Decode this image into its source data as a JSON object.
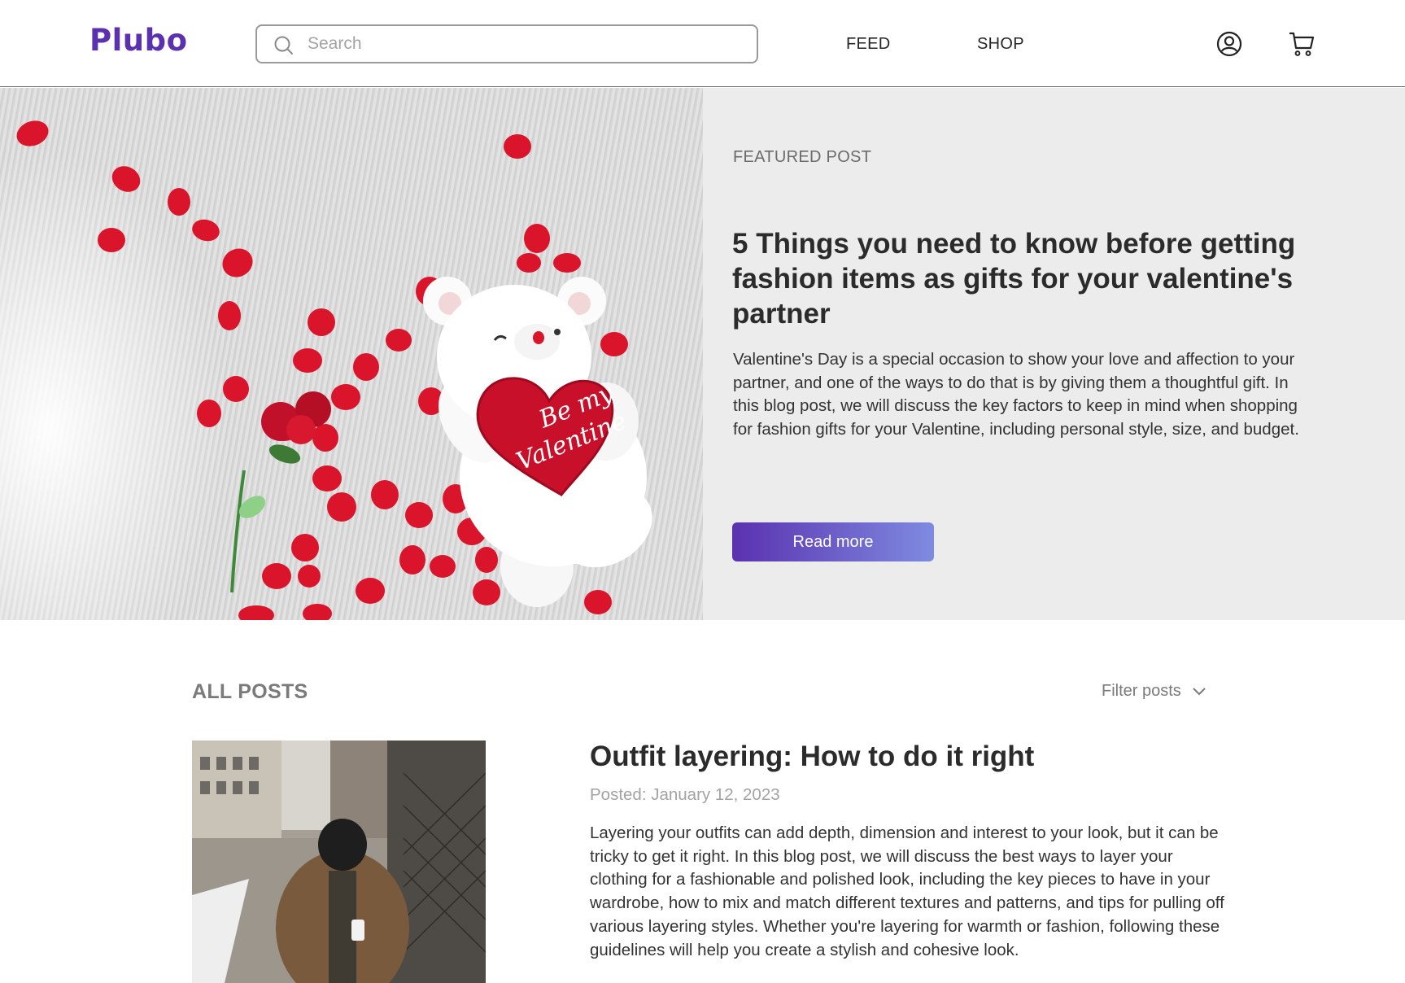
{
  "header": {
    "logo": "Plubo",
    "search": {
      "placeholder": "Search",
      "value": ""
    },
    "nav": [
      {
        "label": "FEED"
      },
      {
        "label": "SHOP"
      }
    ],
    "icons": {
      "account": "user-circle-icon",
      "cart": "cart-icon"
    }
  },
  "featured": {
    "eyebrow": "FEATURED POST",
    "title": "5 Things you need to know before getting fashion items as gifts for your valentine's partner",
    "body": "Valentine's Day is a special occasion to show your love and affection to your partner, and one of the ways to do that is by giving them a thoughtful gift. In this blog post, we will discuss the key factors to keep in mind when shopping for fashion gifts for your Valentine, including personal style, size, and budget.",
    "button_label": "Read more",
    "image_text": "Be my Valentine"
  },
  "posts_section": {
    "heading": "ALL POSTS",
    "filter_label": "Filter posts"
  },
  "posts": [
    {
      "title": "Outfit layering: How to do it right",
      "date": "Posted: January 12, 2023",
      "body": "Layering your outfits can add depth, dimension and interest to your look, but it can be tricky to get it right. In this blog post, we will discuss the best ways to layer your clothing for a fashionable and polished look, including the key pieces to have in your wardrobe, how to mix and match different textures and patterns, and tips for pulling off various layering styles. Whether you're layering for warmth or fashion, following these guidelines will help you create a stylish and cohesive look."
    }
  ],
  "colors": {
    "brand": "#5b31b0",
    "accent": "#e8714a",
    "button_gradient_end": "#7e8be0",
    "featured_bg": "#ececec"
  }
}
